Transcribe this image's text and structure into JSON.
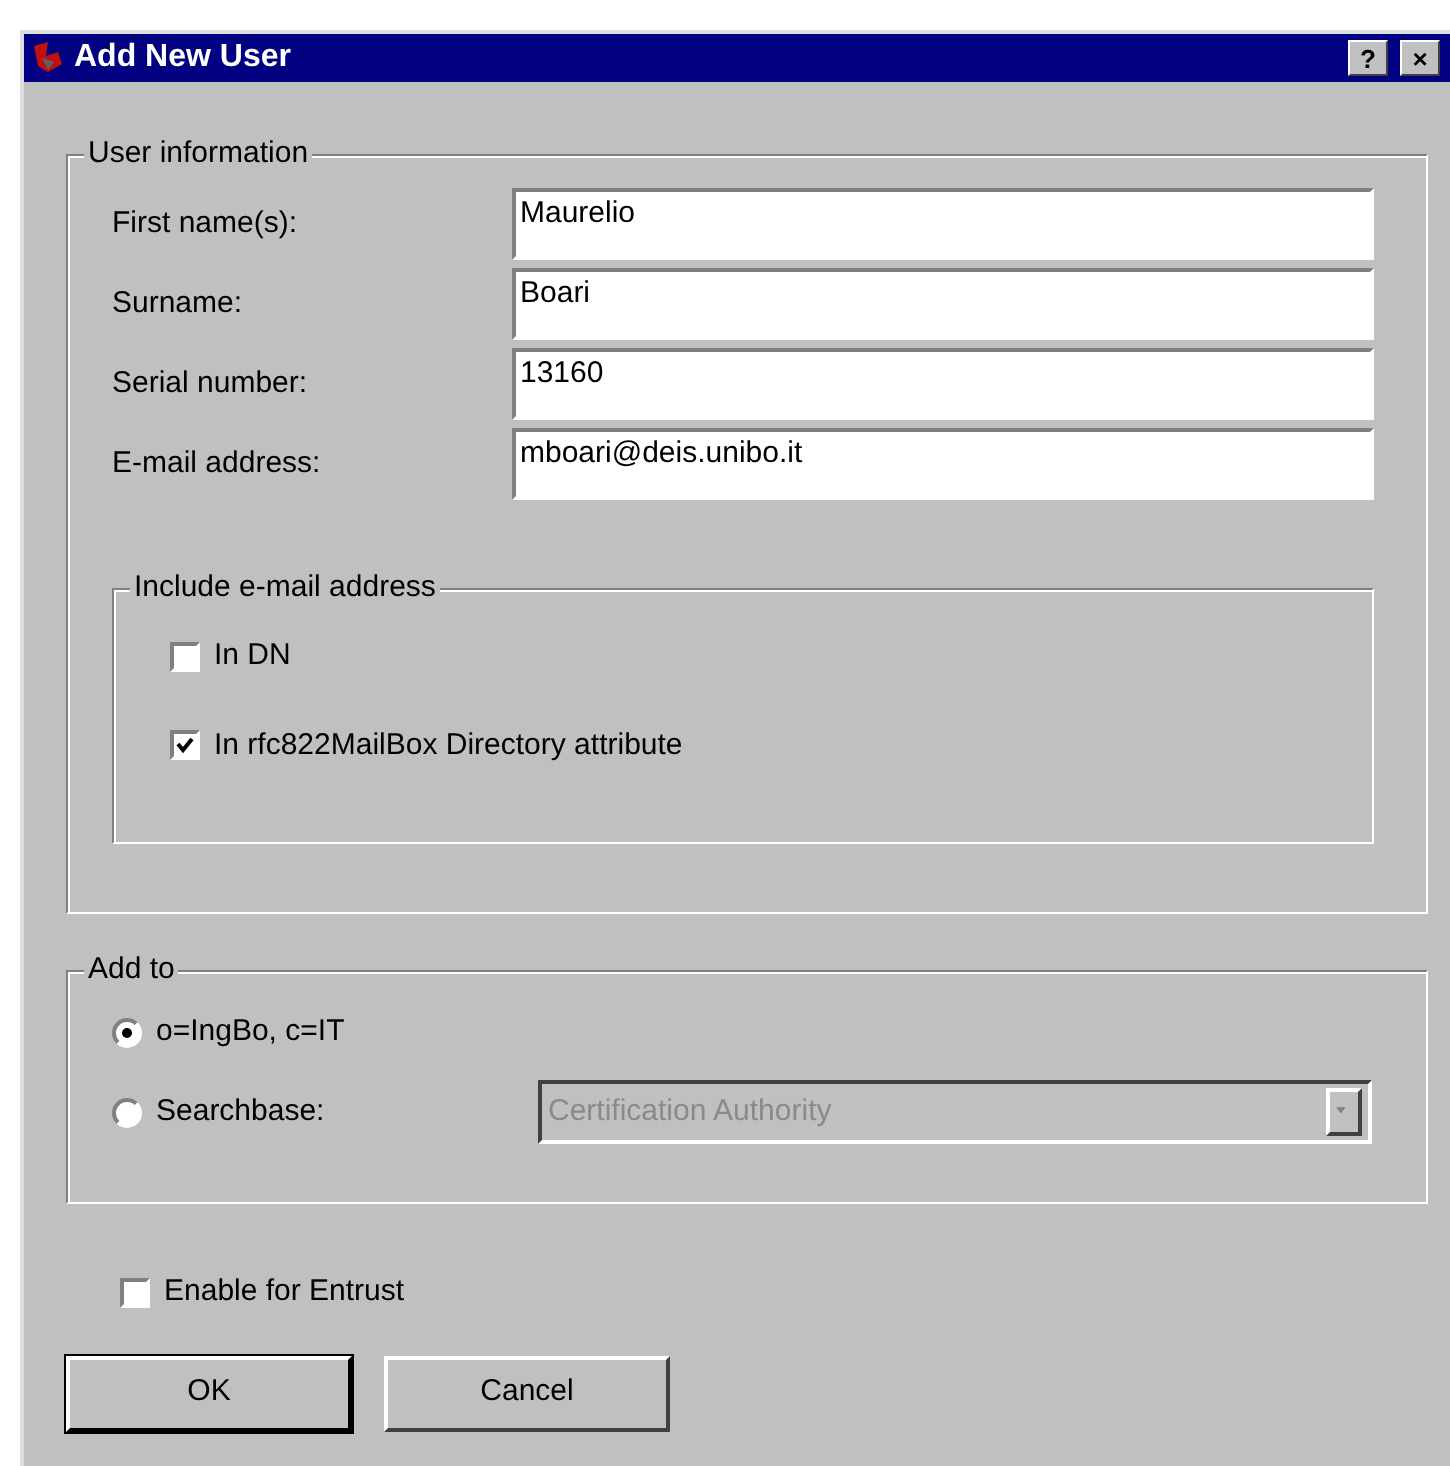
{
  "window": {
    "title": "Add New User",
    "title_buttons": [
      "?",
      "×"
    ]
  },
  "user_information": {
    "title": "User information",
    "fields": [
      {
        "label": "First name(s):",
        "value": "Maurelio"
      },
      {
        "label": "Surname:",
        "value": "Boari"
      },
      {
        "label": "Serial number:",
        "value": "13160"
      },
      {
        "label": "E-mail address:",
        "value": "mboari@deis.unibo.it"
      }
    ],
    "include_email": {
      "title": "Include e-mail address",
      "options": [
        {
          "label": "In DN",
          "checked": false
        },
        {
          "label": "In rfc822MailBox Directory attribute",
          "checked": true
        }
      ]
    }
  },
  "add_to": {
    "title": "Add to",
    "options": [
      {
        "label": "o=IngBo, c=IT",
        "selected": true
      },
      {
        "label": "Searchbase:",
        "selected": false
      }
    ],
    "searchbase": {
      "value": "Certification Authority",
      "disabled": true
    }
  },
  "enable_entrust": {
    "label": "Enable for Entrust",
    "checked": false
  },
  "buttons": [
    "OK",
    "Cancel"
  ]
}
